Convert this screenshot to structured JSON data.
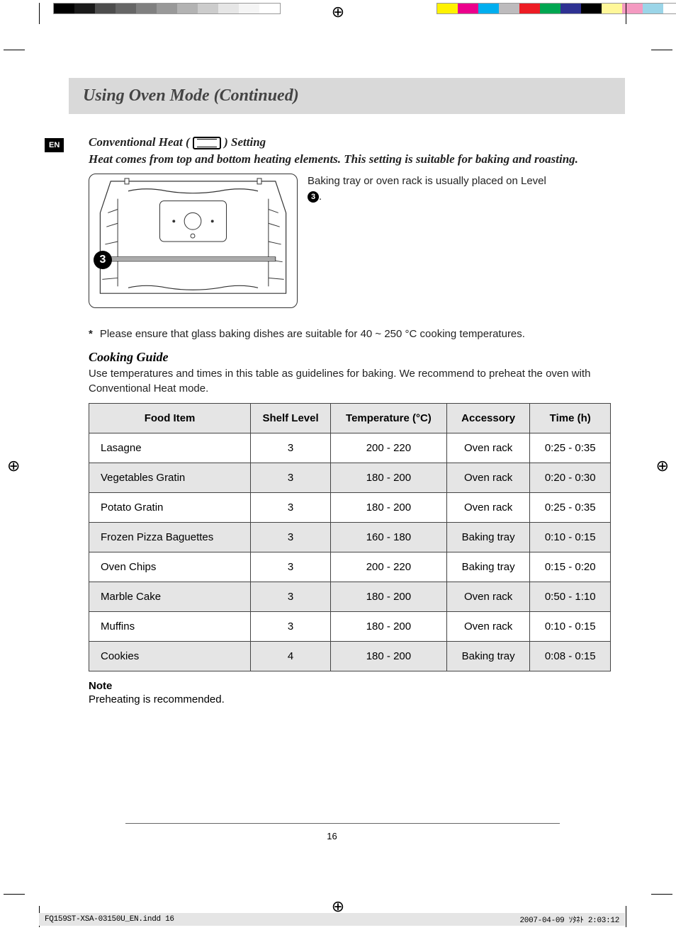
{
  "labels": {
    "language_badge": "EN",
    "page_title": "Using Oven Mode (Continued)",
    "subsection_prefix": "Conventional Heat (",
    "subsection_suffix": " ) Setting",
    "intro": "Heat comes from top and bottom heating elements. This setting is suitable for baking and roasting.",
    "oven_caption_prefix": "Baking tray or oven rack is usually placed on Level ",
    "oven_level": "3",
    "oven_caption_suffix": ".",
    "asterisk_note": "Please ensure that glass baking dishes are suitable for 40 ~ 250 °C cooking temperatures.",
    "asterisk_symbol": "*",
    "guide_title": "Cooking Guide",
    "guide_intro": "Use temperatures and times in this table as guidelines for baking. We recommend to preheat the oven with Conventional Heat mode.",
    "note_heading": "Note",
    "note_text": "Preheating is recommended.",
    "page_number": "16",
    "footer_file": "FQ159ST-XSA-03150U_EN.indd   16",
    "footer_timestamp": "2007-04-09   ｿﾀﾈﾄ 2:03:12"
  },
  "table": {
    "headers": [
      "Food Item",
      "Shelf Level",
      "Temperature (°C)",
      "Accessory",
      "Time (h)"
    ],
    "rows": [
      [
        "Lasagne",
        "3",
        "200 - 220",
        "Oven rack",
        "0:25 - 0:35"
      ],
      [
        "Vegetables Gratin",
        "3",
        "180 - 200",
        "Oven rack",
        "0:20 - 0:30"
      ],
      [
        "Potato Gratin",
        "3",
        "180 - 200",
        "Oven rack",
        "0:25 - 0:35"
      ],
      [
        "Frozen Pizza Baguettes",
        "3",
        "160 - 180",
        "Baking tray",
        "0:10 - 0:15"
      ],
      [
        "Oven Chips",
        "3",
        "200 - 220",
        "Baking tray",
        "0:15 - 0:20"
      ],
      [
        "Marble Cake",
        "3",
        "180 - 200",
        "Oven rack",
        "0:50 - 1:10"
      ],
      [
        "Muffins",
        "3",
        "180 - 200",
        "Oven rack",
        "0:10 - 0:15"
      ],
      [
        "Cookies",
        "4",
        "180 - 200",
        "Baking tray",
        "0:08 - 0:15"
      ]
    ]
  },
  "chart_data": {
    "type": "table",
    "title": "Cooking Guide — Conventional Heat",
    "columns": [
      "Food Item",
      "Shelf Level",
      "Temperature (°C)",
      "Accessory",
      "Time (h)"
    ],
    "rows": [
      {
        "food_item": "Lasagne",
        "shelf_level": 3,
        "temperature_c": "200 - 220",
        "accessory": "Oven rack",
        "time_h": "0:25 - 0:35"
      },
      {
        "food_item": "Vegetables Gratin",
        "shelf_level": 3,
        "temperature_c": "180 - 200",
        "accessory": "Oven rack",
        "time_h": "0:20 - 0:30"
      },
      {
        "food_item": "Potato Gratin",
        "shelf_level": 3,
        "temperature_c": "180 - 200",
        "accessory": "Oven rack",
        "time_h": "0:25 - 0:35"
      },
      {
        "food_item": "Frozen Pizza Baguettes",
        "shelf_level": 3,
        "temperature_c": "160 - 180",
        "accessory": "Baking tray",
        "time_h": "0:10 - 0:15"
      },
      {
        "food_item": "Oven Chips",
        "shelf_level": 3,
        "temperature_c": "200 - 220",
        "accessory": "Baking tray",
        "time_h": "0:15 - 0:20"
      },
      {
        "food_item": "Marble Cake",
        "shelf_level": 3,
        "temperature_c": "180 - 200",
        "accessory": "Oven rack",
        "time_h": "0:50 - 1:10"
      },
      {
        "food_item": "Muffins",
        "shelf_level": 3,
        "temperature_c": "180 - 200",
        "accessory": "Oven rack",
        "time_h": "0:10 - 0:15"
      },
      {
        "food_item": "Cookies",
        "shelf_level": 4,
        "temperature_c": "180 - 200",
        "accessory": "Baking tray",
        "time_h": "0:08 - 0:15"
      }
    ]
  },
  "print_palette": {
    "grays": [
      "#000000",
      "#1a1a1a",
      "#4d4d4d",
      "#666666",
      "#808080",
      "#999999",
      "#b3b3b3",
      "#cccccc",
      "#e6e6e6",
      "#f5f5f5",
      "#ffffff"
    ],
    "colors": [
      "#fff200",
      "#ec008c",
      "#00aeef",
      "#bdbbbd",
      "#ed1c24",
      "#00a651",
      "#2e3192",
      "#000000",
      "#fff799",
      "#f49ac1",
      "#9bd5e8",
      "#ffffff"
    ]
  }
}
